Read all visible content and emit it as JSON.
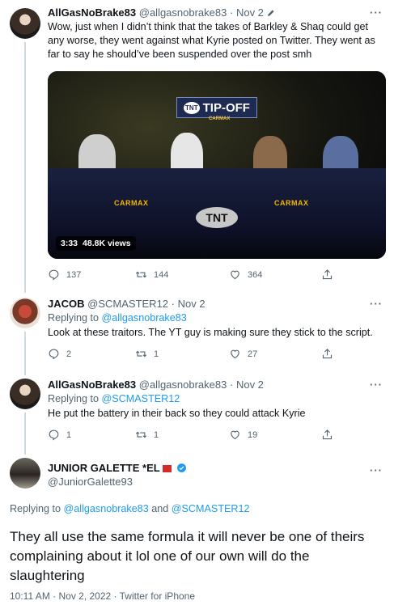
{
  "tweets": [
    {
      "name": "AllGasNoBrake83",
      "handle": "@allgasnobrake83",
      "date": "Nov 2",
      "text": "Wow, just when I didn’t think that the takes of Barkley & Shaq could get any worse, they went against what Kyrie posted on Twitter. They went as far to say he should’ve been suspended over the post smh",
      "video": {
        "duration": "3:33",
        "views": "48.8K views",
        "overlay": "TIP-OFF",
        "sponsor": "CARMAX",
        "network": "TNT",
        "overlay_badge": "TNT",
        "overlay_sub": "CARMAX"
      },
      "replies": "137",
      "retweets": "144",
      "likes": "364"
    },
    {
      "name": "JACOB",
      "handle": "@SCMASTER12",
      "date": "Nov 2",
      "replying_prefix": "Replying to",
      "replying_to": "@allgasnobrake83",
      "text": "Look at these traitors. The YT guy is making sure they stick to the script.",
      "replies": "2",
      "retweets": "1",
      "likes": "27"
    },
    {
      "name": "AllGasNoBrake83",
      "handle": "@allgasnobrake83",
      "date": "Nov 2",
      "replying_prefix": "Replying to",
      "replying_to": "@SCMASTER12",
      "text": "He put the battery in their back so they could attack Kyrie",
      "replies": "1",
      "retweets": "1",
      "likes": "19"
    }
  ],
  "focus": {
    "name": "JUNIOR GALETTE *EL",
    "handle": "@JuniorGalette93",
    "replying_prefix": "Replying to",
    "replying_to_1": "@allgasnobrake83",
    "replying_and": "and",
    "replying_to_2": "@SCMASTER12",
    "text": "They all use the same formula it will never be one of theirs complaining about it lol one of our own will do the slaughtering",
    "meta": "10:11 AM · Nov 2, 2022 · Twitter for iPhone"
  },
  "ui": {
    "more": "···",
    "dot": "·"
  },
  "colors": {
    "accent": "#1d9bf0",
    "muted": "#536471",
    "text": "#0f1419",
    "thread_line": "#cfd9de"
  },
  "icons": [
    "reply-icon",
    "retweet-icon",
    "like-icon",
    "share-icon",
    "more-icon",
    "verified-icon",
    "edit-icon"
  ]
}
